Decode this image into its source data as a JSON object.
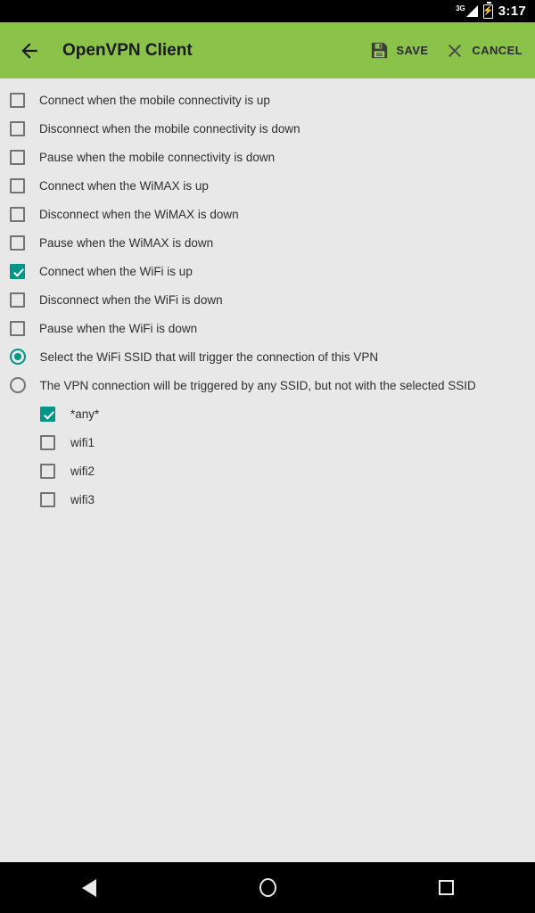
{
  "status_bar": {
    "network_label": "3G",
    "network_icon": "signal-3g-icon",
    "battery_icon": "battery-charging-icon",
    "time": "3:17"
  },
  "app_bar": {
    "back_icon": "back-arrow-icon",
    "title": "OpenVPN Client",
    "save_icon": "floppy-disk-icon",
    "save_label": "SAVE",
    "cancel_icon": "close-x-icon",
    "cancel_label": "CANCEL",
    "background_color": "#8bc34a"
  },
  "settings": {
    "accent_color": "#009688",
    "checkbox_options": [
      {
        "label": "Connect when the mobile connectivity is up",
        "checked": false
      },
      {
        "label": "Disconnect when the mobile connectivity is down",
        "checked": false
      },
      {
        "label": "Pause when the mobile connectivity is down",
        "checked": false
      },
      {
        "label": "Connect when the WiMAX is up",
        "checked": false
      },
      {
        "label": "Disconnect when the WiMAX is down",
        "checked": false
      },
      {
        "label": "Pause when the WiMAX is down",
        "checked": false
      },
      {
        "label": "Connect when the WiFi is up",
        "checked": true
      },
      {
        "label": "Disconnect when the WiFi is down",
        "checked": false
      },
      {
        "label": "Pause when the WiFi is down",
        "checked": false
      }
    ],
    "ssid_trigger_options": [
      {
        "label": "Select the WiFi SSID that will trigger the connection of this VPN",
        "selected": true
      },
      {
        "label": "The VPN connection will be triggered by any SSID, but not with the selected SSID",
        "selected": false
      }
    ],
    "ssid_list": [
      {
        "label": "*any*",
        "checked": true
      },
      {
        "label": "wifi1",
        "checked": false
      },
      {
        "label": "wifi2",
        "checked": false
      },
      {
        "label": "wifi3",
        "checked": false
      }
    ]
  },
  "nav_bar": {
    "back_icon": "nav-back-icon",
    "home_icon": "nav-home-icon",
    "recents_icon": "nav-recents-icon"
  }
}
